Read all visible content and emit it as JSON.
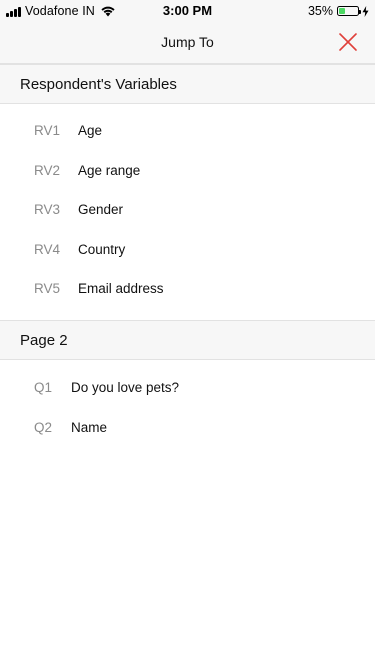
{
  "status_bar": {
    "carrier": "Vodafone IN",
    "time": "3:00 PM",
    "battery_percent": "35%",
    "battery_level": 0.35,
    "battery_color": "#4cd964"
  },
  "nav": {
    "title": "Jump To",
    "close_icon": "close-x-icon",
    "close_color": "#e0403a"
  },
  "sections": [
    {
      "title": "Respondent's Variables",
      "items": [
        {
          "code": "RV1",
          "label": "Age"
        },
        {
          "code": "RV2",
          "label": "Age range"
        },
        {
          "code": "RV3",
          "label": "Gender"
        },
        {
          "code": "RV4",
          "label": "Country"
        },
        {
          "code": "RV5",
          "label": "Email address"
        }
      ]
    },
    {
      "title": "Page 2",
      "items": [
        {
          "code": "Q1",
          "label": "Do you love pets?"
        },
        {
          "code": "Q2",
          "label": "Name"
        }
      ]
    }
  ]
}
